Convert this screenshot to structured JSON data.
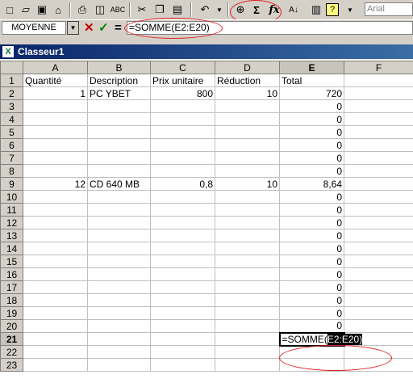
{
  "toolbar": {
    "font_name": "Arial",
    "icons": [
      "new-icon",
      "open-icon",
      "save-icon",
      "permission-icon",
      "print-icon",
      "print-preview-icon",
      "spelling-icon",
      "cut-icon",
      "copy-icon",
      "paste-icon",
      "undo-icon",
      "hyperlink-icon",
      "autosum-icon",
      "function-icon",
      "sort-icon",
      "chart-icon",
      "help-icon"
    ]
  },
  "formula_bar": {
    "name_box": "MOYENNE",
    "formula": "=SOMME(E2:E20)"
  },
  "window": {
    "title": "Classeur1"
  },
  "columns": [
    "",
    "A",
    "B",
    "C",
    "D",
    "E",
    "F"
  ],
  "rows": [
    {
      "n": "1",
      "a": "Quantité",
      "b": "Description",
      "c": "Prix unitaire",
      "d": "Réduction",
      "e": "Total"
    },
    {
      "n": "2",
      "a": "1",
      "b": "PC YBET",
      "c": "800",
      "d": "10",
      "e": "720"
    },
    {
      "n": "3",
      "a": "",
      "b": "",
      "c": "",
      "d": "",
      "e": "0"
    },
    {
      "n": "4",
      "a": "",
      "b": "",
      "c": "",
      "d": "",
      "e": "0"
    },
    {
      "n": "5",
      "a": "",
      "b": "",
      "c": "",
      "d": "",
      "e": "0"
    },
    {
      "n": "6",
      "a": "",
      "b": "",
      "c": "",
      "d": "",
      "e": "0"
    },
    {
      "n": "7",
      "a": "",
      "b": "",
      "c": "",
      "d": "",
      "e": "0"
    },
    {
      "n": "8",
      "a": "",
      "b": "",
      "c": "",
      "d": "",
      "e": "0"
    },
    {
      "n": "9",
      "a": "12",
      "b": "CD 640 MB",
      "c": "0,8",
      "d": "10",
      "e": "8,64"
    },
    {
      "n": "10",
      "a": "",
      "b": "",
      "c": "",
      "d": "",
      "e": "0"
    },
    {
      "n": "11",
      "a": "",
      "b": "",
      "c": "",
      "d": "",
      "e": "0"
    },
    {
      "n": "12",
      "a": "",
      "b": "",
      "c": "",
      "d": "",
      "e": "0"
    },
    {
      "n": "13",
      "a": "",
      "b": "",
      "c": "",
      "d": "",
      "e": "0"
    },
    {
      "n": "14",
      "a": "",
      "b": "",
      "c": "",
      "d": "",
      "e": "0"
    },
    {
      "n": "15",
      "a": "",
      "b": "",
      "c": "",
      "d": "",
      "e": "0"
    },
    {
      "n": "16",
      "a": "",
      "b": "",
      "c": "",
      "d": "",
      "e": "0"
    },
    {
      "n": "17",
      "a": "",
      "b": "",
      "c": "",
      "d": "",
      "e": "0"
    },
    {
      "n": "18",
      "a": "",
      "b": "",
      "c": "",
      "d": "",
      "e": "0"
    },
    {
      "n": "19",
      "a": "",
      "b": "",
      "c": "",
      "d": "",
      "e": "0"
    },
    {
      "n": "20",
      "a": "",
      "b": "",
      "c": "",
      "d": "",
      "e": "0"
    },
    {
      "n": "21",
      "a": "",
      "b": "",
      "c": "",
      "d": "",
      "e": ""
    },
    {
      "n": "22",
      "a": "",
      "b": "",
      "c": "",
      "d": "",
      "e": ""
    },
    {
      "n": "23",
      "a": "",
      "b": "",
      "c": "",
      "d": "",
      "e": ""
    }
  ],
  "edit_cell": {
    "prefix": "=SOMME(",
    "range": "E2:E20",
    "suffix": ")"
  },
  "colors": {
    "annotation": "#e02020",
    "title_bar": "#0a246a"
  }
}
